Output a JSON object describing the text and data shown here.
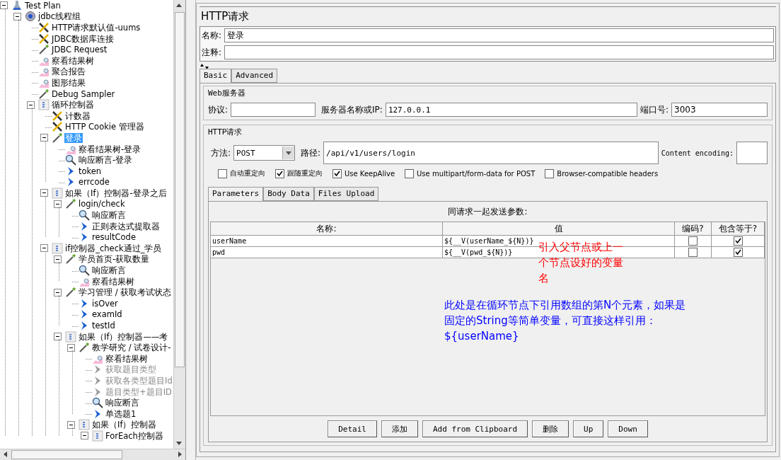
{
  "tree": [
    {
      "label": "Test Plan",
      "kind": "plan",
      "expanded": true,
      "selected": false,
      "disabled": false,
      "children": [
        {
          "label": "jdbc线程组",
          "kind": "threads",
          "expanded": true,
          "selected": false,
          "disabled": false,
          "children": [
            {
              "label": "HTTP请求默认值-uums",
              "kind": "config",
              "selected": false,
              "disabled": false
            },
            {
              "label": "JDBC数据库连接",
              "kind": "config",
              "selected": false,
              "disabled": false
            },
            {
              "label": "JDBC Request",
              "kind": "sampler",
              "selected": false,
              "disabled": false
            },
            {
              "label": "察看结果树",
              "kind": "listener",
              "selected": false,
              "disabled": false
            },
            {
              "label": "聚合报告",
              "kind": "listener",
              "selected": false,
              "disabled": false
            },
            {
              "label": "图形结果",
              "kind": "listener",
              "selected": false,
              "disabled": false
            },
            {
              "label": "Debug Sampler",
              "kind": "sampler",
              "selected": false,
              "disabled": false
            },
            {
              "label": "循环控制器",
              "kind": "controller",
              "expanded": true,
              "selected": false,
              "disabled": false,
              "children": [
                {
                  "label": "计数器",
                  "kind": "config",
                  "selected": false,
                  "disabled": false
                },
                {
                  "label": "HTTP Cookie 管理器",
                  "kind": "config",
                  "selected": false,
                  "disabled": false
                },
                {
                  "label": "登录",
                  "kind": "sampler",
                  "expanded": true,
                  "selected": true,
                  "disabled": false,
                  "children": [
                    {
                      "label": "察看结果树-登录",
                      "kind": "listener",
                      "selected": false,
                      "disabled": false
                    },
                    {
                      "label": "响应断言-登录",
                      "kind": "assertion",
                      "selected": false,
                      "disabled": false
                    },
                    {
                      "label": "token",
                      "kind": "extractor",
                      "selected": false,
                      "disabled": false
                    },
                    {
                      "label": "errcode",
                      "kind": "extractor",
                      "selected": false,
                      "disabled": false
                    }
                  ]
                },
                {
                  "label": "如果（If）控制器-登录之后",
                  "kind": "controller",
                  "expanded": true,
                  "selected": false,
                  "disabled": false,
                  "children": [
                    {
                      "label": "login/check",
                      "kind": "sampler",
                      "expanded": true,
                      "selected": false,
                      "disabled": false,
                      "children": [
                        {
                          "label": "响应断言",
                          "kind": "assertion",
                          "selected": false,
                          "disabled": false
                        },
                        {
                          "label": "正则表达式提取器",
                          "kind": "extractor",
                          "selected": false,
                          "disabled": false
                        },
                        {
                          "label": "resultCode",
                          "kind": "extractor",
                          "selected": false,
                          "disabled": false
                        }
                      ]
                    }
                  ]
                },
                {
                  "label": "if控制器_check通过_学员",
                  "kind": "controller",
                  "expanded": true,
                  "selected": false,
                  "disabled": false,
                  "children": [
                    {
                      "label": "学员首页-获取数量",
                      "kind": "sampler",
                      "expanded": true,
                      "selected": false,
                      "disabled": false,
                      "children": [
                        {
                          "label": "响应断言",
                          "kind": "assertion",
                          "selected": false,
                          "disabled": false
                        },
                        {
                          "label": "察看结果树",
                          "kind": "listener",
                          "selected": false,
                          "disabled": false
                        }
                      ]
                    },
                    {
                      "label": "学习管理 / 获取考试状态",
                      "kind": "sampler",
                      "expanded": true,
                      "selected": false,
                      "disabled": false,
                      "children": [
                        {
                          "label": "isOver",
                          "kind": "extractor",
                          "selected": false,
                          "disabled": false
                        },
                        {
                          "label": "examId",
                          "kind": "extractor",
                          "selected": false,
                          "disabled": false
                        },
                        {
                          "label": "testId",
                          "kind": "extractor",
                          "selected": false,
                          "disabled": false
                        }
                      ]
                    },
                    {
                      "label": "如果（If）控制器——考",
                      "kind": "controller",
                      "expanded": true,
                      "selected": false,
                      "disabled": false,
                      "children": [
                        {
                          "label": "教学研究 / 试卷设计-",
                          "kind": "sampler",
                          "expanded": true,
                          "selected": false,
                          "disabled": false,
                          "children": [
                            {
                              "label": "察看结果树",
                              "kind": "listener",
                              "selected": false,
                              "disabled": false
                            },
                            {
                              "label": "获取题目类型",
                              "kind": "extractor",
                              "selected": false,
                              "disabled": true
                            },
                            {
                              "label": "获取各类型题目Id",
                              "kind": "extractor",
                              "selected": false,
                              "disabled": true
                            },
                            {
                              "label": "题目类型+题目ID",
                              "kind": "extractor",
                              "selected": false,
                              "disabled": true
                            },
                            {
                              "label": "响应断言",
                              "kind": "assertion",
                              "selected": false,
                              "disabled": false
                            },
                            {
                              "label": "单选题1",
                              "kind": "extractor",
                              "selected": false,
                              "disabled": false
                            }
                          ]
                        },
                        {
                          "label": "如果（If）控制器",
                          "kind": "controller",
                          "expanded": true,
                          "selected": false,
                          "disabled": false,
                          "children": [
                            {
                              "label": "ForEach控制器",
                              "kind": "controller",
                              "expanded": true,
                              "selected": false,
                              "disabled": false
                            }
                          ]
                        }
                      ]
                    }
                  ]
                }
              ]
            }
          ]
        }
      ]
    }
  ],
  "panel": {
    "title": "HTTP请求",
    "name_label": "名称:",
    "name_value": "登录",
    "comment_label": "注释:"
  },
  "tabs": [
    {
      "label": "Basic",
      "selected": true
    },
    {
      "label": "Advanced",
      "selected": false
    }
  ],
  "web_server": {
    "legend": "Web服务器",
    "protocol_label": "协议:",
    "server_label": "服务器名称或IP:",
    "server": "127.0.0.1",
    "port_label": "端口号:",
    "port": "3003"
  },
  "http_request": {
    "legend": "HTTP请求",
    "method_label": "方法:",
    "method": "POST",
    "path_label": "路径:",
    "path": "/api/v1/users/login",
    "encoding_label": "Content encoding:",
    "options": [
      {
        "label": "自动重定向",
        "checked": false
      },
      {
        "label": "跟随重定向",
        "checked": true
      },
      {
        "label": "Use KeepAlive",
        "checked": true
      },
      {
        "label": "Use multipart/form-data for POST",
        "checked": false
      },
      {
        "label": "Browser-compatible headers",
        "checked": false
      }
    ]
  },
  "sub_tabs": [
    {
      "label": "Parameters",
      "selected": true
    },
    {
      "label": "Body Data",
      "selected": false
    },
    {
      "label": "Files Upload",
      "selected": false
    }
  ],
  "params": {
    "caption": "同请求一起发送参数:",
    "columns": [
      "名称:",
      "值",
      "编码?",
      "包含等于?"
    ],
    "rows": [
      {
        "name": "userName",
        "value": "${__V(userName_${N})}",
        "encode": false,
        "include_equals": true
      },
      {
        "name": "pwd",
        "value": "${__V(pwd_${N})}",
        "encode": false,
        "include_equals": true
      }
    ]
  },
  "annotations": [
    {
      "text": "引入父节点或上一个节点设好的变量名",
      "color": "#ff0000"
    },
    {
      "text": "此处是在循环节点下引用数组的第N个元素，如果是固定的String等简单变量，可直接这样引用：${userName}",
      "color": "#0000ff"
    }
  ],
  "buttons": [
    "Detail",
    "添加",
    "Add from Clipboard",
    "删除",
    "Up",
    "Down"
  ]
}
